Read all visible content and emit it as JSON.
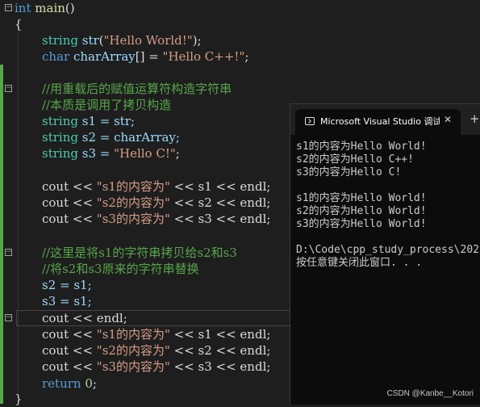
{
  "code": {
    "l1": {
      "kw": "int",
      "fn": "main",
      "rest": "()"
    },
    "l2": "{",
    "l3": {
      "ty": "string",
      "id": "str",
      "p1": "(",
      "s": "\"Hello World!\"",
      "p2": ");"
    },
    "l4": {
      "kw": "char",
      "id": "charArray",
      "mid": "[] = ",
      "s": "\"Hello C++!\"",
      "end": ";"
    },
    "c1": "//用重载后的赋值运算符构造字符串",
    "c2": "//本质是调用了拷贝构造",
    "a1": {
      "ty": "string",
      "rest": "s1 = str;"
    },
    "a2": {
      "ty": "string",
      "rest": "s2 = charArray;"
    },
    "a3": {
      "ty": "string",
      "id": "s3 = ",
      "s": "\"Hello C!\"",
      "end": ";"
    },
    "o1": {
      "a": "cout << ",
      "s": "\"s1的内容为\"",
      "b": " << s1 << endl;"
    },
    "o2": {
      "a": "cout << ",
      "s": "\"s2的内容为\"",
      "b": " << s2 << endl;"
    },
    "o3": {
      "a": "cout << ",
      "s": "\"s3的内容为\"",
      "b": " << s3 << endl;"
    },
    "c3": "//这里是将s1的字符串拷贝给s2和s3",
    "c4": "//将s2和s3原来的字符串替换",
    "b1": "s2 = s1;",
    "b2": "s3 = s1;",
    "b3": "cout << endl;",
    "o4": {
      "a": "cout << ",
      "s": "\"s1的内容为\"",
      "b": " << s1 << endl;"
    },
    "o5": {
      "a": "cout << ",
      "s": "\"s2的内容为\"",
      "b": " << s2 << endl;"
    },
    "o6": {
      "a": "cout << ",
      "s": "\"s3的内容为\"",
      "b": " << s3 << endl;"
    },
    "ret": {
      "kw": "return",
      "num": "0",
      "end": ";"
    },
    "close": "}"
  },
  "console": {
    "title": "Microsoft Visual Studio 调试控",
    "close_glyph": "✕",
    "add_glyph": "+",
    "lines": [
      "s1的内容为Hello World!",
      "s2的内容为Hello C++!",
      "s3的内容为Hello C!",
      "",
      "s1的内容为Hello World!",
      "s2的内容为Hello World!",
      "s3的内容为Hello World!",
      "",
      "D:\\Code\\cpp_study_process\\202",
      "按任意键关闭此窗口. . ."
    ]
  },
  "watermark": "CSDN @Kanbe__Kotori",
  "colors": {
    "keyword": "#569cd6",
    "type": "#4ec9b0",
    "string": "#d69d85",
    "comment": "#57a64a",
    "background": "#1e1e1e",
    "console_bg": "#0c0c0c"
  },
  "icons": {
    "fold": "fold-minus-icon",
    "terminal": "terminal-icon",
    "close": "close-icon",
    "add": "add-tab-icon"
  }
}
